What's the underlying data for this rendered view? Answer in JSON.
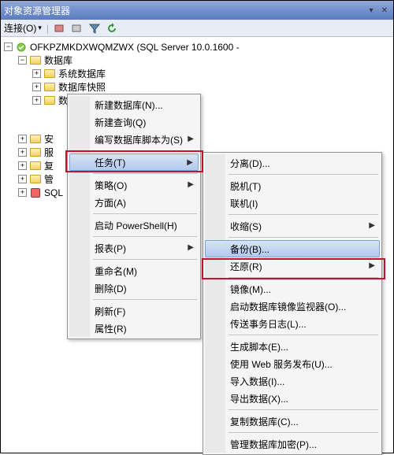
{
  "title": "对象资源管理器",
  "toolbar": {
    "connect": "连接(O)"
  },
  "tree": {
    "server": "OFKPZMKDXWQMZWX (SQL Server 10.0.1600 -",
    "db_root": "数据库",
    "sys_db": "系统数据库",
    "db_snapshot": "数据库快照",
    "partial_db": "数",
    "sec": "安",
    "srv": "服",
    "rep": "复",
    "mgmt": "管",
    "agent": "SQL"
  },
  "menu1": {
    "new_db": "新建数据库(N)...",
    "new_query": "新建查询(Q)",
    "script_db": "编写数据库脚本为(S)",
    "tasks": "任务(T)",
    "policies": "策略(O)",
    "facets": "方面(A)",
    "powershell": "启动 PowerShell(H)",
    "reports": "报表(P)",
    "rename": "重命名(M)",
    "delete": "删除(D)",
    "refresh": "刷新(F)",
    "properties": "属性(R)"
  },
  "menu2": {
    "detach": "分离(D)...",
    "offline": "脱机(T)",
    "online": "联机(I)",
    "shrink": "收缩(S)",
    "backup": "备份(B)...",
    "restore": "还原(R)",
    "mirror": "镜像(M)...",
    "db_mirror_mon": "启动数据库镜像监视器(O)...",
    "ship_log": "传送事务日志(L)...",
    "gen_script": "生成脚本(E)...",
    "web_publish": "使用 Web 服务发布(U)...",
    "import": "导入数据(I)...",
    "export": "导出数据(X)...",
    "copy_db": "复制数据库(C)...",
    "manage_enc": "管理数据库加密(P)..."
  }
}
